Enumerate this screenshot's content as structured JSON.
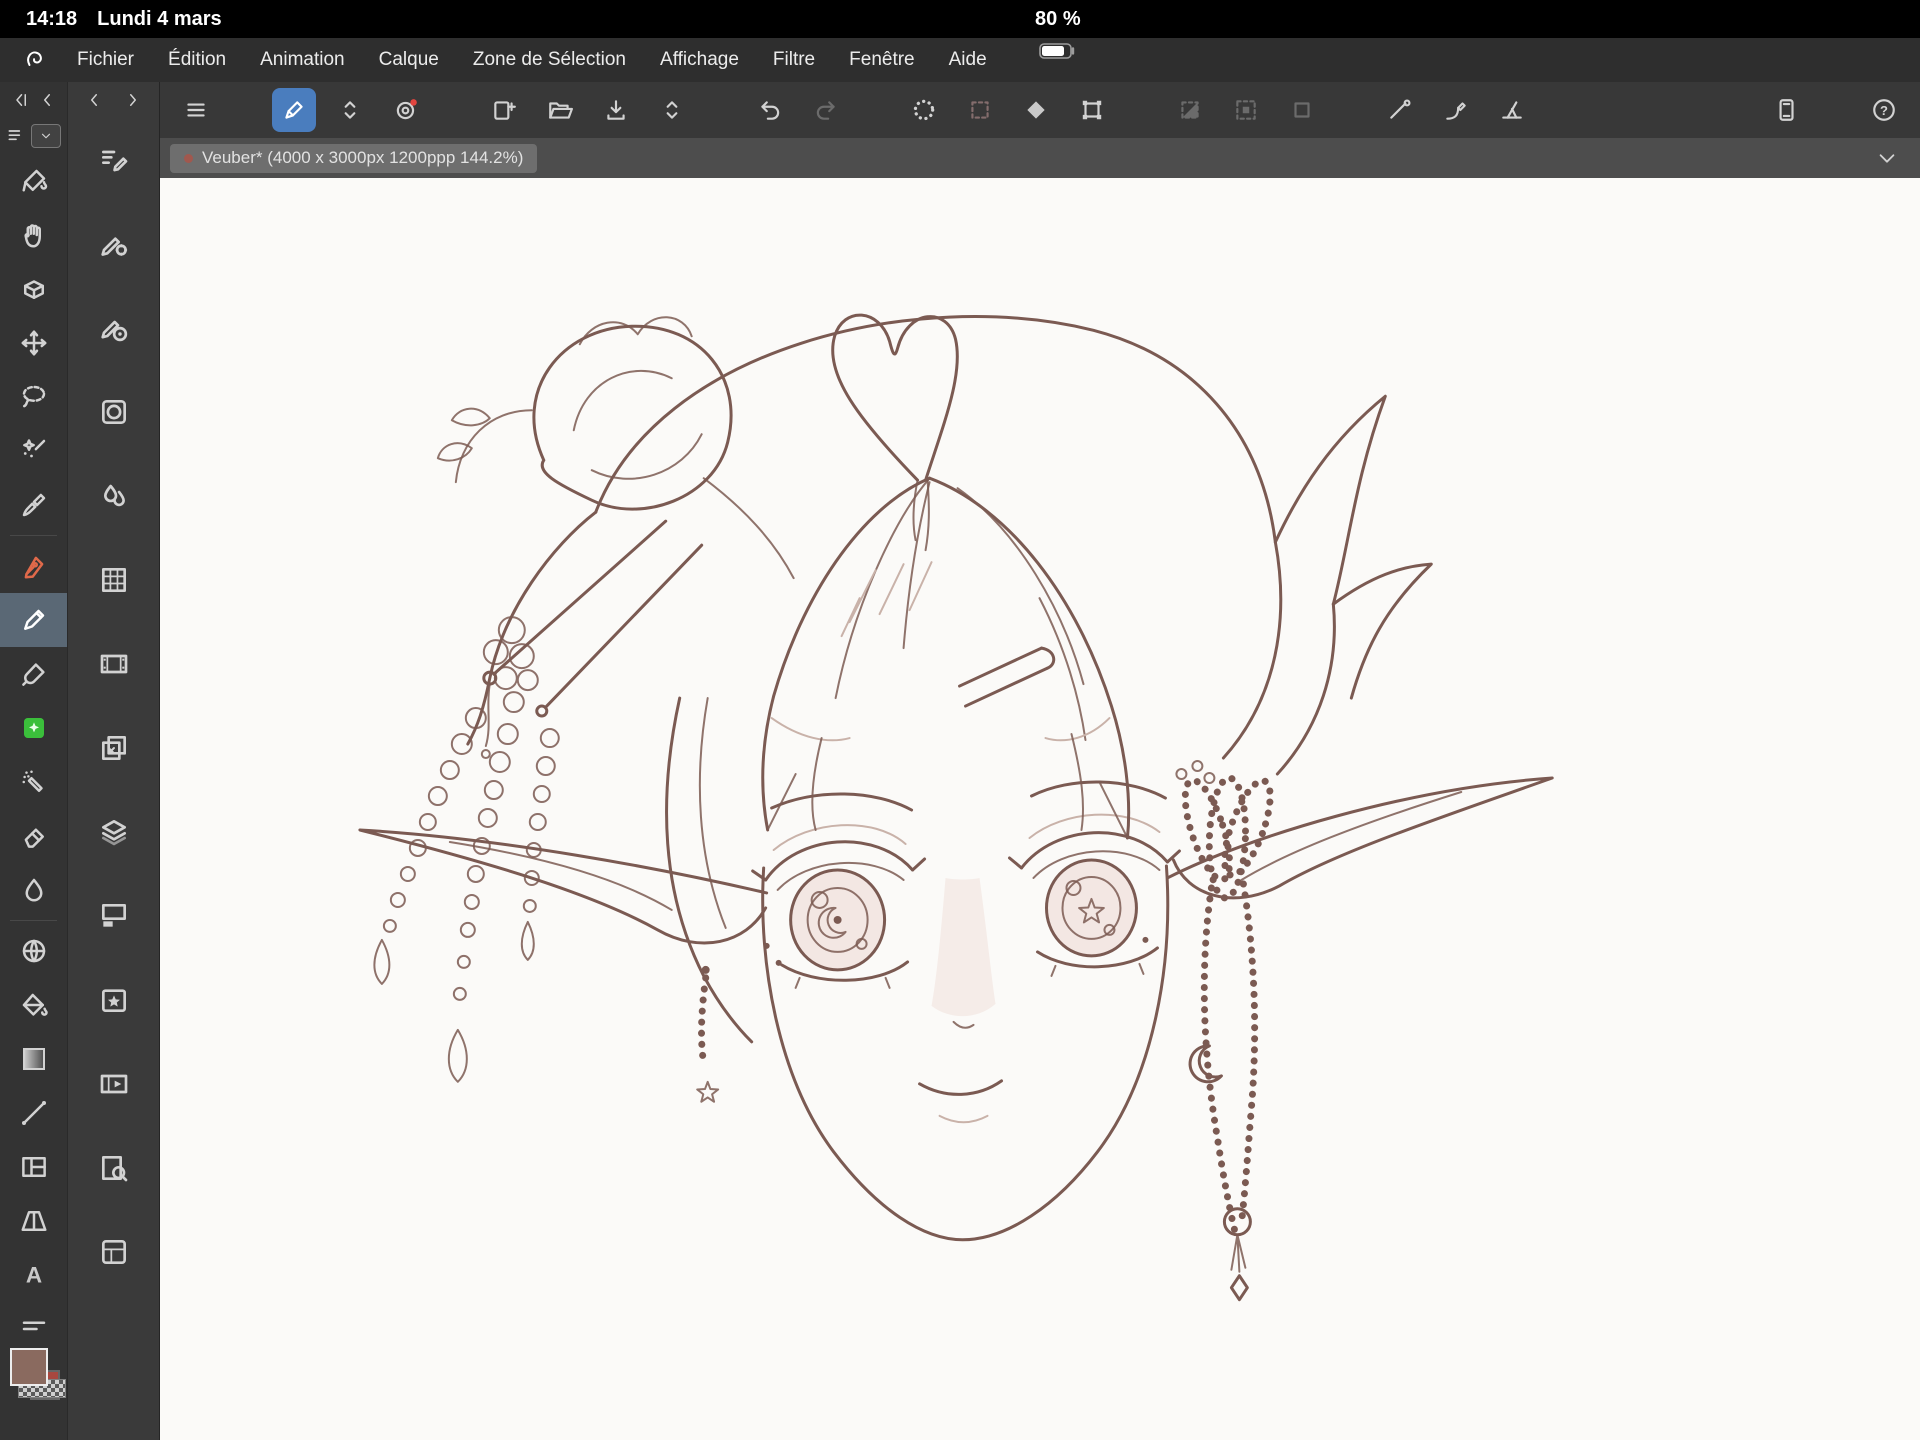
{
  "status_bar": {
    "time": "14:18",
    "date": "Lundi 4 mars",
    "battery": "80 %"
  },
  "menu_bar": {
    "logo_icon": "clip-studio-logo",
    "items": [
      "Fichier",
      "Édition",
      "Animation",
      "Calque",
      "Zone de Sélection",
      "Affichage",
      "Filtre",
      "Fenêtre",
      "Aide"
    ]
  },
  "toolbar": {
    "buttons": [
      "main-menu",
      "current-tool",
      "tool-switcher",
      "resource-ring",
      "new-canvas",
      "open-file",
      "export-save",
      "save-switcher",
      "undo",
      "redo",
      "select-launcher",
      "deselect",
      "clear-selection",
      "transform",
      "selection-invert",
      "selection-expand",
      "selection-mask",
      "snap-to-ruler",
      "snap-to-special-ruler",
      "snap-to-perspective",
      "companion-mode",
      "help"
    ],
    "selected": "current-tool",
    "disabled": [
      "redo",
      "selection-invert",
      "selection-expand",
      "selection-mask"
    ],
    "notification_dot_color": "#e2453f"
  },
  "document_tab": {
    "label": "Veuber* (4000 x 3000px 1200ppp 144.2%)",
    "unsaved": true
  },
  "tools": {
    "items": [
      "paint-pour",
      "hand",
      "object",
      "move-layer",
      "lasso-select",
      "auto-select",
      "eyedropper",
      "pen",
      "pencil",
      "brush",
      "decoration",
      "airbrush",
      "eraser",
      "blend",
      "mesh",
      "fill",
      "gradient",
      "figure",
      "frame-border",
      "perspective",
      "text",
      "ruler"
    ],
    "selected": "pencil",
    "pen_accent": "#e0694a",
    "decoration_accent": "#3bbf3b"
  },
  "palettes": {
    "items": [
      "quick-access",
      "subtool-detail",
      "brush-size",
      "tool-property",
      "color-mix",
      "color-set",
      "timeline",
      "layer-search",
      "layer-property",
      "layers",
      "materials",
      "animation-cels",
      "subview",
      "item-bank"
    ]
  },
  "colors": {
    "selected_tool_bg": "#5a6875",
    "active_button_bg": "#4a7dbe",
    "primary_swatch": "#8a6a5f",
    "secondary_swatch": "#a84840",
    "line_art": "#7b5a52",
    "canvas_bg": "#fbfaf8"
  },
  "glyphs": {
    "letter_a": "A",
    "question_mark": "?"
  }
}
